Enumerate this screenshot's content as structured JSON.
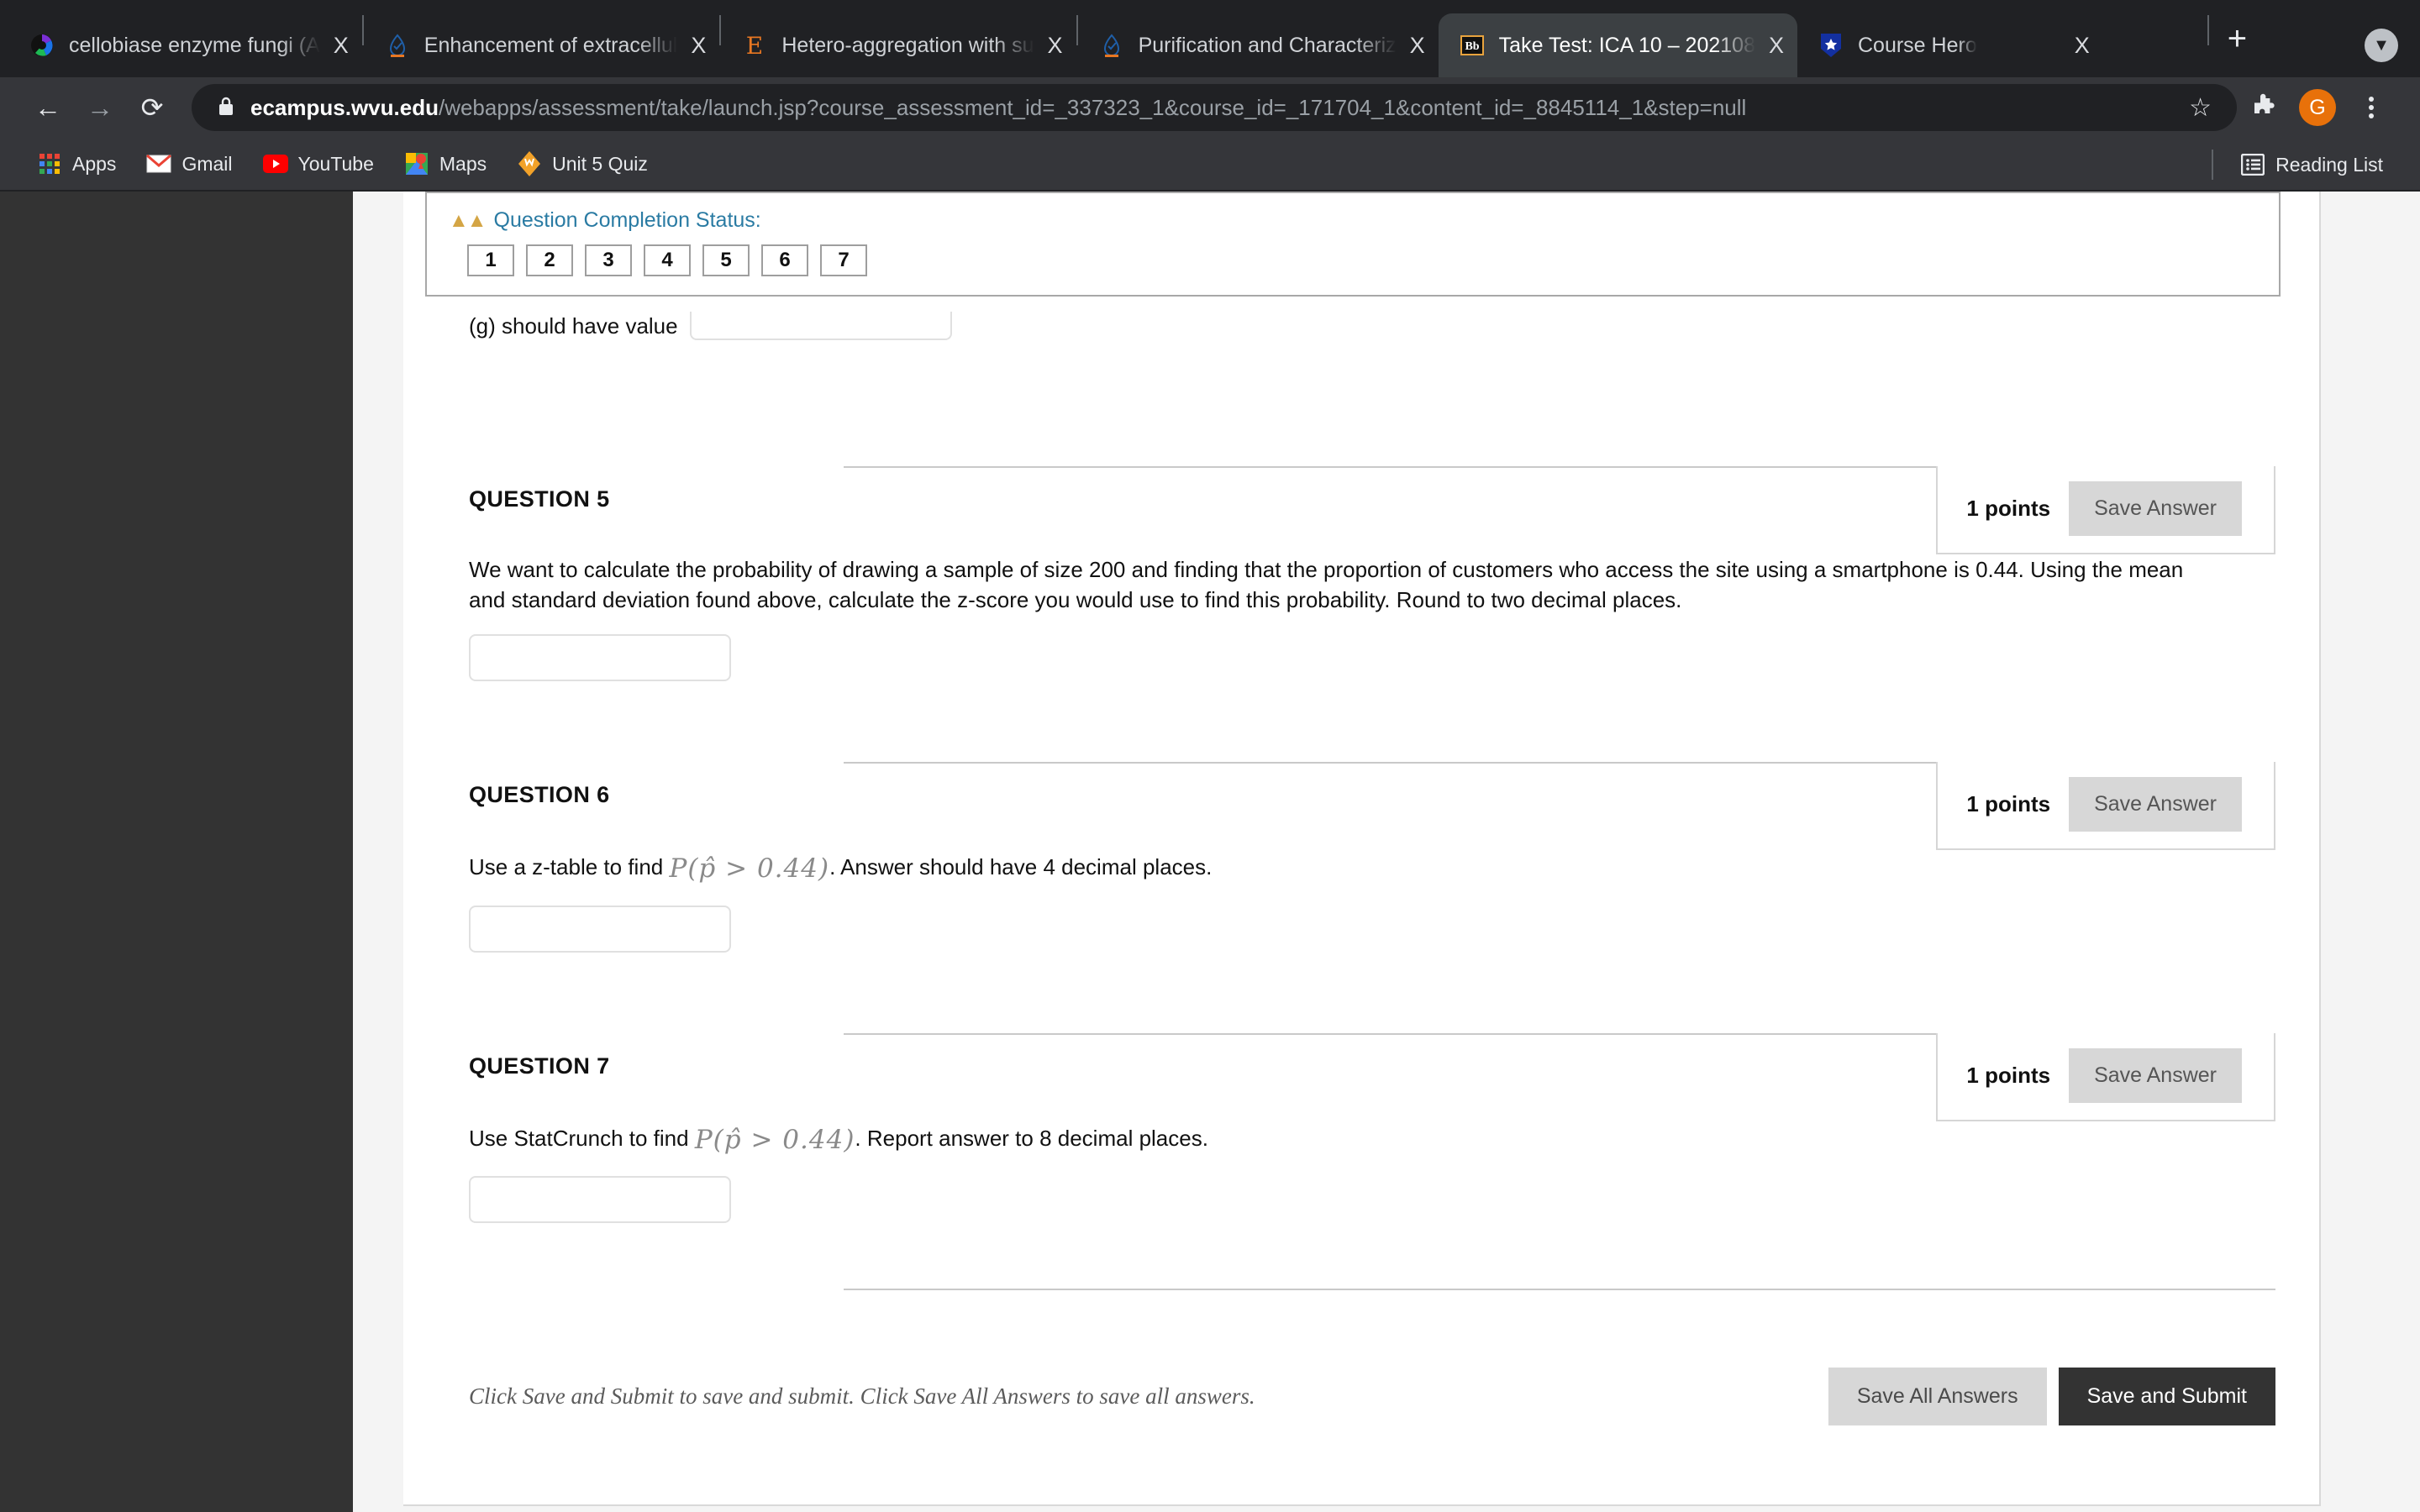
{
  "browser": {
    "tabs": [
      {
        "title": "cellobiase enzyme fungi (A",
        "favicon": "chrome-multicolor-icon",
        "active": false,
        "close_label": "X"
      },
      {
        "title": "Enhancement of extracellul",
        "favicon": "sciencedirect-icon",
        "active": false,
        "close_label": "X"
      },
      {
        "title": "Hetero-aggregation with su",
        "favicon": "elsevier-e-icon",
        "active": false,
        "close_label": "X"
      },
      {
        "title": "Purification and Characteriz",
        "favicon": "sciencedirect-icon",
        "active": false,
        "close_label": "X"
      },
      {
        "title": "Take Test: ICA 10 – 202108",
        "favicon": "blackboard-bb-icon",
        "active": true,
        "close_label": "X"
      },
      {
        "title": "Course Hero",
        "favicon": "coursehero-shield-icon",
        "active": false,
        "close_label": "X"
      }
    ],
    "new_tab_label": "+",
    "window_caret_label": "▼",
    "nav": {
      "back_label": "←",
      "forward_label": "→",
      "reload_label": "⟳"
    },
    "omnibox": {
      "lock_icon": "lock-icon",
      "host": "ecampus.wvu.edu",
      "path": "/webapps/assessment/take/launch.jsp?course_assessment_id=_337323_1&course_id=_171704_1&content_id=_8845114_1&step=null",
      "star_label": "☆"
    },
    "toolbar_icons": [
      "extensions-puzzle-icon",
      "profile-avatar-icon",
      "chrome-menu-icon"
    ],
    "profile_initial": "G",
    "bookmarks": [
      {
        "label": "Apps",
        "icon": "apps-grid-icon"
      },
      {
        "label": "Gmail",
        "icon": "gmail-icon"
      },
      {
        "label": "YouTube",
        "icon": "youtube-icon"
      },
      {
        "label": "Maps",
        "icon": "google-maps-icon"
      },
      {
        "label": "Unit 5 Quiz",
        "icon": "wvu-diamond-icon"
      }
    ],
    "reading_list": {
      "label": "Reading List",
      "icon": "reading-list-icon"
    }
  },
  "completion_status": {
    "label": "Question Completion Status:",
    "collapse_icon": "double-chevron-up-icon",
    "questions": [
      "1",
      "2",
      "3",
      "4",
      "5",
      "6",
      "7"
    ]
  },
  "partial_question": {
    "text": "(g) should have value",
    "input_value": ""
  },
  "questions": [
    {
      "title": "QUESTION 5",
      "points": "1 points",
      "save_label": "Save Answer",
      "text": "We want to calculate the probability of drawing a sample of size 200 and finding that the proportion of customers who access the site using a smartphone is 0.44. Using the mean and standard deviation found above, calculate the z-score you would use to find this probability. Round to two decimal places.",
      "math": "",
      "text_after": "",
      "input_value": ""
    },
    {
      "title": "QUESTION 6",
      "points": "1 points",
      "save_label": "Save Answer",
      "text": "Use a z-table to find ",
      "math": "P(p̂ > 0.44)",
      "text_after": ". Answer should have 4 decimal places.",
      "input_value": ""
    },
    {
      "title": "QUESTION 7",
      "points": "1 points",
      "save_label": "Save Answer",
      "text": "Use StatCrunch to find ",
      "math": "P(p̂ > 0.44)",
      "text_after": ". Report answer to 8 decimal places.",
      "input_value": ""
    }
  ],
  "footer": {
    "note": "Click Save and Submit to save and submit. Click Save All Answers to save all answers.",
    "save_all_label": "Save All Answers",
    "save_submit_label": "Save and Submit"
  },
  "colors": {
    "chrome_tabstrip": "#202124",
    "chrome_toolbar": "#35363a",
    "link_blue": "#2a7ba3",
    "accent_gold": "#d4a545",
    "avatar_orange": "#e8710a",
    "btn_dark": "#333333",
    "btn_light": "#d7d7d7"
  }
}
